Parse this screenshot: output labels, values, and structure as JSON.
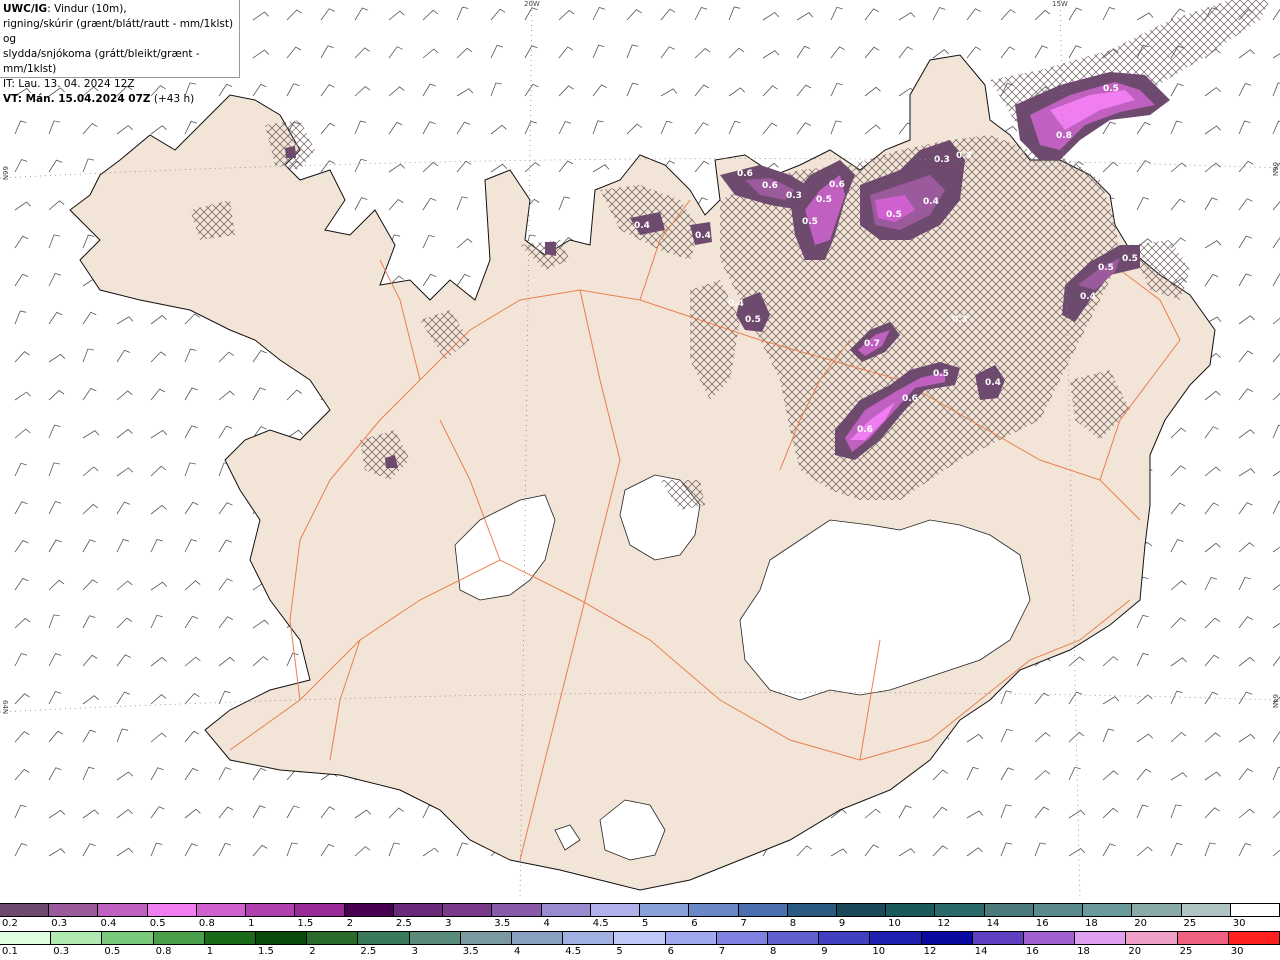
{
  "header": {
    "model": "UWC/IG",
    "line1_rest": ": Vindur (10m),",
    "line2": "rigning/skúrir (grænt/blátt/rautt - mm/1klst) og",
    "line3": "slydda/snjókoma (grátt/bleikt/grænt - mm/1klst)",
    "it": "IT: Lau. 13. 04. 2024 12Z",
    "vt": "VT: Mán. 15.04.2024 07Z",
    "vt_offset": "(+43 h)"
  },
  "grid_labels": {
    "lon_20": "20W",
    "lon_15": "15W",
    "lat_66_left": "66N",
    "lat_66_right": "66N",
    "lat_64_left": "64N",
    "lat_64_right": "64N"
  },
  "snow_labels": [
    "0.6",
    "0.6",
    "0.3",
    "0.5",
    "0.6",
    "0.5",
    "0.4",
    "0.3",
    "0.3",
    "0.5",
    "0.8",
    "0.4",
    "0.5",
    "0.4",
    "0.5",
    "0.5",
    "0.7",
    "0.5",
    "0.4",
    "0.6",
    "0.6",
    "0.5",
    "0.4",
    "0.4",
    "0.3"
  ],
  "legend": {
    "snow_labels": [
      "0.2",
      "0.3",
      "0.4",
      "0.5",
      "0.8",
      "1",
      "1.5",
      "2",
      "2.5",
      "3",
      "3.5",
      "4",
      "4.5",
      "5",
      "6",
      "7",
      "8",
      "9",
      "10",
      "12",
      "14",
      "16",
      "18",
      "20",
      "25",
      "30"
    ],
    "snow_colors": [
      "#6e4a6e",
      "#9b5a9b",
      "#c060c0",
      "#f07ef0",
      "#d060d0",
      "#b040b0",
      "#9a2a9a",
      "#4a0050",
      "#6a2a7a",
      "#7a3a8a",
      "#8a5aaa",
      "#9a8ad0",
      "#b0b0ea",
      "#8aa0d8",
      "#6a88c8",
      "#4a70b0",
      "#2a5a80",
      "#1a4a5a",
      "#1a5a5a",
      "#2a6a6a",
      "#4a7a7a",
      "#5a8a8a",
      "#6a9a9a",
      "#8aaaaa",
      "#b0c4c4",
      "#ffffff"
    ],
    "rain_labels": [
      "0.1",
      "0.3",
      "0.5",
      "0.8",
      "1",
      "1.5",
      "2",
      "2.5",
      "3",
      "3.5",
      "4",
      "4.5",
      "5",
      "6",
      "7",
      "8",
      "9",
      "10",
      "12",
      "14",
      "16",
      "18",
      "20",
      "25",
      "30"
    ],
    "rain_colors": [
      "#e0ffe0",
      "#b0eab0",
      "#7ac87a",
      "#4aa04a",
      "#1a6a1a",
      "#0a4a0a",
      "#2a6a2a",
      "#3a7a5a",
      "#5a8a7a",
      "#7a9aa0",
      "#8aa0c0",
      "#a0b0e0",
      "#c0c8f8",
      "#a0a8f0",
      "#8080e0",
      "#6060d0",
      "#4040c0",
      "#2020b0",
      "#0a0aa0",
      "#6040c0",
      "#a060d0",
      "#e0a0f0",
      "#f0a0c8",
      "#f06080",
      "#ff2020"
    ]
  }
}
